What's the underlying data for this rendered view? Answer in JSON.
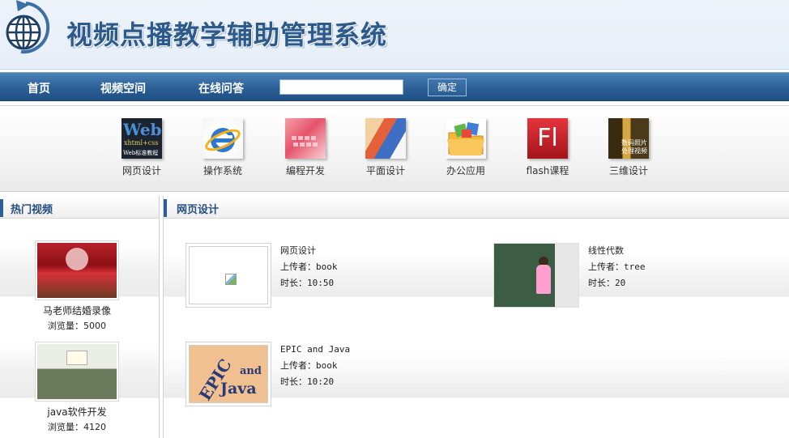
{
  "header": {
    "title": "视频点播教学辅助管理系统",
    "logo_icon": "globe-refresh-icon"
  },
  "nav": {
    "items": [
      {
        "label": "首页"
      },
      {
        "label": "视频空间"
      },
      {
        "label": "在线问答"
      }
    ],
    "search_value": "",
    "submit_label": "确定"
  },
  "categories": [
    {
      "label": "网页设计",
      "icon": "web-design-icon"
    },
    {
      "label": "操作系统",
      "icon": "ie-browser-icon"
    },
    {
      "label": "编程开发",
      "icon": "keyboard-icon"
    },
    {
      "label": "平面设计",
      "icon": "graphic-design-icon"
    },
    {
      "label": "办公应用",
      "icon": "folder-icon"
    },
    {
      "label": "flash课程",
      "icon": "flash-icon"
    },
    {
      "label": "三维设计",
      "icon": "3d-design-icon"
    }
  ],
  "category_thumb_text": {
    "web_line1": "Web",
    "web_line2": "xhtml+css",
    "web_line3": "Web标准教程",
    "flash": "Fl",
    "three_d": "数码照片处理视频"
  },
  "sidebar": {
    "title": "热门视频",
    "items": [
      {
        "title": "马老师结婚录像",
        "views": "浏览量：5000"
      },
      {
        "title": "java软件开发",
        "views": "浏览量：4120"
      }
    ]
  },
  "main": {
    "title": "网页设计",
    "videos": [
      {
        "name": "网页设计",
        "uploader": "上传者：book",
        "duration": "时长：10:50"
      },
      {
        "name": "线性代数",
        "uploader": "上传者：tree",
        "duration": "时长：20"
      },
      {
        "name": "EPIC and Java",
        "uploader": "上传者：book",
        "duration": "时长：10:20"
      }
    ],
    "epic_cover": {
      "word1": "EPIC",
      "word2": "and",
      "word3": "Java"
    }
  },
  "colors": {
    "nav_bg": "#2c5f95",
    "title_blue": "#2c5a8c",
    "panel_accent": "#2c5f95"
  }
}
